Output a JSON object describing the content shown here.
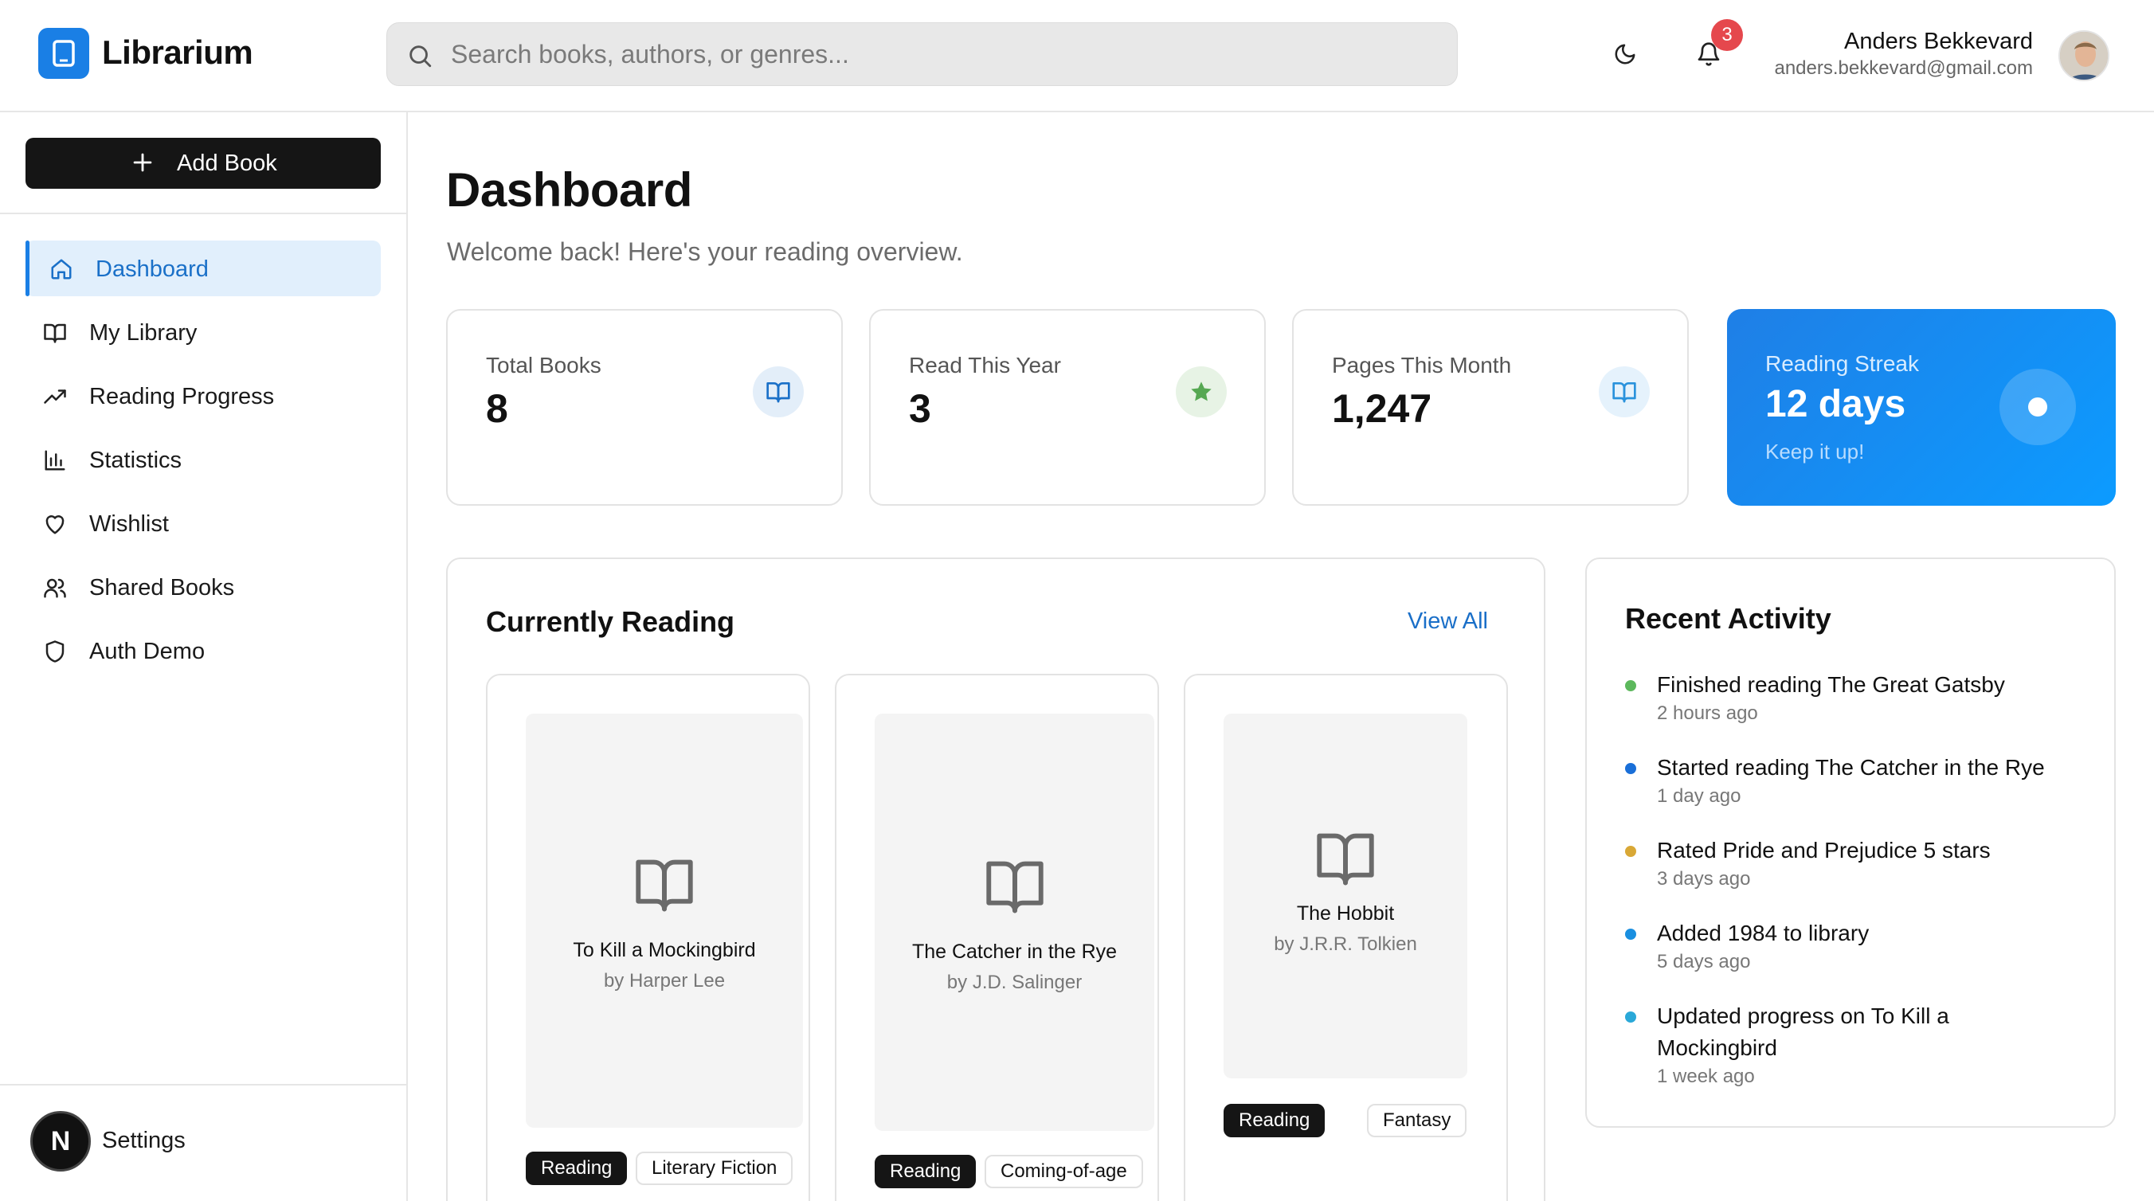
{
  "app": {
    "name": "Librarium",
    "accent_color": "#1a7fe5"
  },
  "search": {
    "placeholder": "Search books, authors, or genres..."
  },
  "header": {
    "notification_count": "3",
    "user_name": "Anders Bekkevard",
    "user_email": "anders.bekkevard@gmail.com"
  },
  "sidebar": {
    "add_book_label": "Add Book",
    "items": [
      {
        "label": "Dashboard",
        "icon": "home-icon",
        "active": true
      },
      {
        "label": "My Library",
        "icon": "book-open-icon"
      },
      {
        "label": "Reading Progress",
        "icon": "trending-up-icon"
      },
      {
        "label": "Statistics",
        "icon": "bar-chart-icon"
      },
      {
        "label": "Wishlist",
        "icon": "heart-icon"
      },
      {
        "label": "Shared Books",
        "icon": "users-icon"
      },
      {
        "label": "Auth Demo",
        "icon": "shield-icon"
      }
    ],
    "footer_avatar_letter": "N",
    "settings_label": "Settings"
  },
  "main": {
    "title": "Dashboard",
    "subtitle": "Welcome back! Here's your reading overview.",
    "stats": [
      {
        "label": "Total Books",
        "value": "8",
        "icon": "book-open-icon"
      },
      {
        "label": "Read This Year",
        "value": "3",
        "icon": "star-icon"
      },
      {
        "label": "Pages This Month",
        "value": "1,247",
        "icon": "book-open-icon"
      }
    ],
    "streak": {
      "label": "Reading Streak",
      "value": "12 days",
      "sub": "Keep it up!"
    },
    "currently_reading": {
      "title": "Currently Reading",
      "view_all": "View All",
      "books": [
        {
          "title": "To Kill a Mockingbird",
          "author": "by Harper Lee",
          "status": "Reading",
          "genre": "Literary Fiction"
        },
        {
          "title": "The Catcher in the Rye",
          "author": "by J.D. Salinger",
          "status": "Reading",
          "genre": "Coming-of-age"
        },
        {
          "title": "The Hobbit",
          "author": "by J.R.R. Tolkien",
          "status": "Reading",
          "genre": "Fantasy"
        }
      ]
    },
    "recent_activity": {
      "title": "Recent Activity",
      "items": [
        {
          "action": "Finished reading ",
          "subject": "The Great Gatsby",
          "suffix": "",
          "time": "2 hours ago",
          "color": "#5cb85c"
        },
        {
          "action": "Started reading ",
          "subject": "The Catcher in the Rye",
          "suffix": "",
          "time": "1 day ago",
          "color": "#1a6fd8"
        },
        {
          "action": "Rated ",
          "subject": "Pride and Prejudice",
          "suffix": " 5 stars",
          "time": "3 days ago",
          "color": "#d9a836"
        },
        {
          "action": "Added ",
          "subject": "1984",
          "suffix": " to library",
          "time": "5 days ago",
          "color": "#1a8fe0"
        },
        {
          "action": "Updated progress on ",
          "subject": "To Kill a Mockingbird",
          "suffix": "",
          "time": "1 week ago",
          "color": "#2aa8d8"
        }
      ]
    }
  }
}
